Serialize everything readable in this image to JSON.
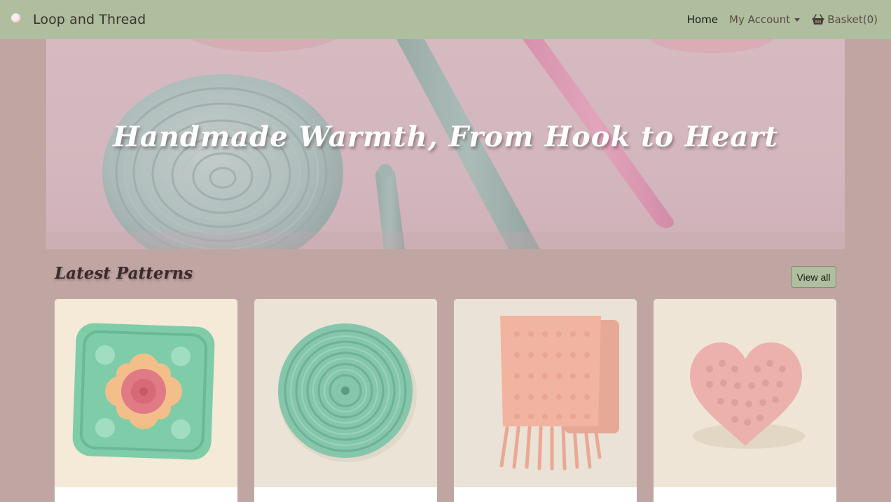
{
  "brand": {
    "name": "Loop and Thread"
  },
  "nav": {
    "home": "Home",
    "account": "My Account",
    "basket": "Basket(0)"
  },
  "hero": {
    "title": "Handmade Warmth, From Hook to Heart"
  },
  "latest": {
    "title": "Latest Patterns",
    "view_all": "View all"
  },
  "patterns": [
    {
      "image": "granny-square"
    },
    {
      "image": "round-coaster"
    },
    {
      "image": "pink-scarf"
    },
    {
      "image": "pink-heart"
    }
  ],
  "colors": {
    "navbar": "#afbe9e",
    "background": "#c0a6a2",
    "button": "#afbe9e"
  }
}
